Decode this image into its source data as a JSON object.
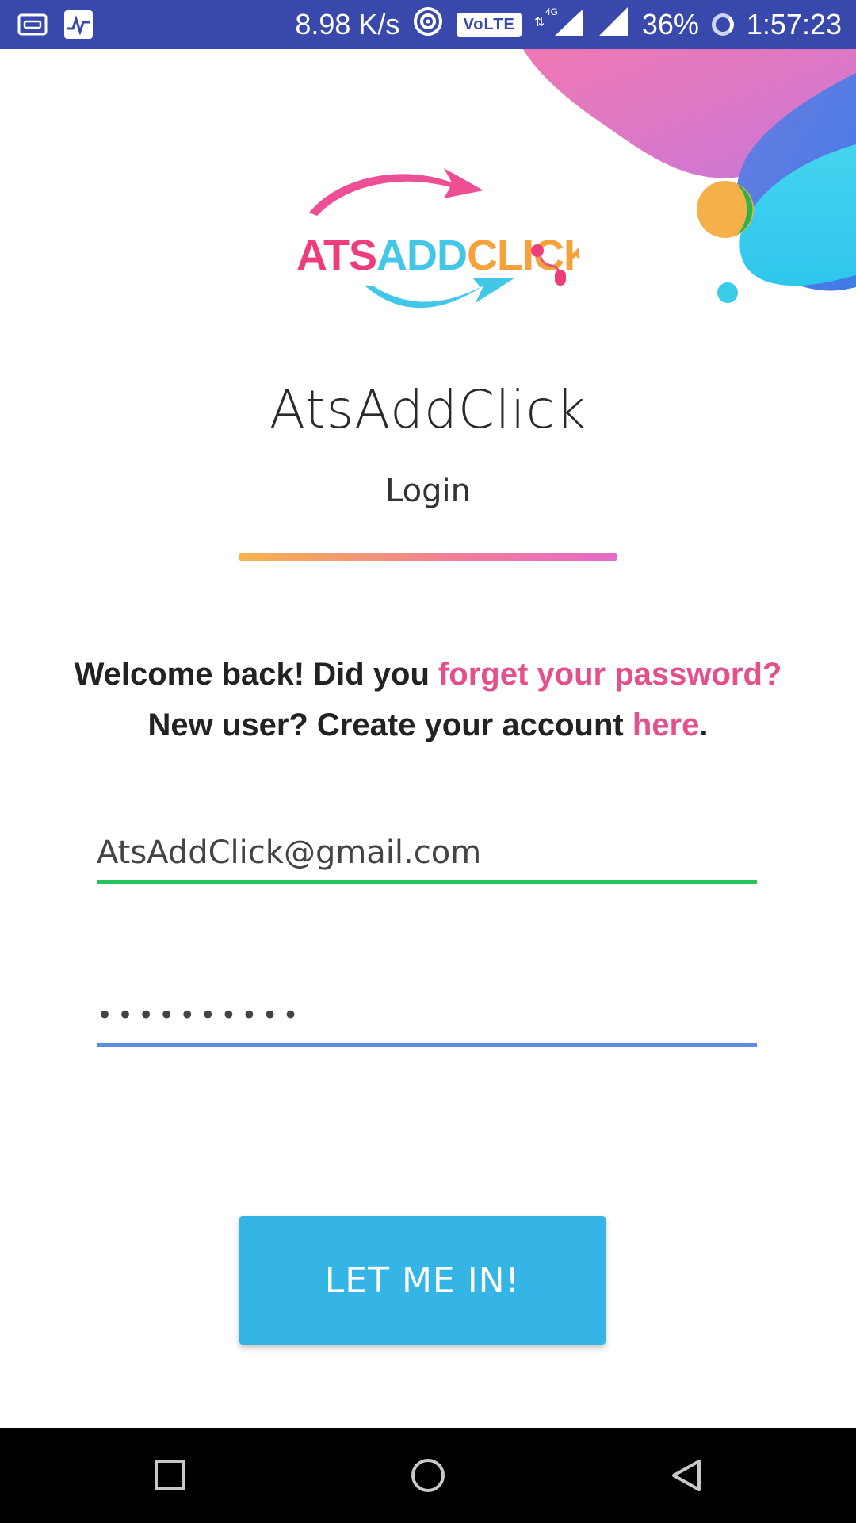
{
  "status_bar": {
    "speed": "8.98 K/s",
    "volte": "VoLTE",
    "network": "4G",
    "battery": "36%",
    "time": "1:57:23"
  },
  "logo": {
    "text_parts": [
      "ATS",
      "ADD",
      "CLICK"
    ],
    "colors": [
      "#ee3d7a",
      "#43c7e8",
      "#f5a23c"
    ]
  },
  "app": {
    "title": "AtsAddClick",
    "subtitle": "Login"
  },
  "welcome": {
    "line1_prefix": "Welcome back! Did you ",
    "forgot_link": "forget your password?",
    "line2_prefix": "New user? Create your account ",
    "here_link": "here",
    "line2_suffix": "."
  },
  "form": {
    "email_value": "AtsAddClick@gmail.com",
    "password_value": "••••••••••"
  },
  "button": {
    "label": "LET ME IN!"
  },
  "colors": {
    "status_bar": "#3949ab",
    "accent_pink": "#e4508c",
    "email_underline": "#2ac25c",
    "password_underline": "#5b8de6",
    "button": "#35b5e6"
  }
}
